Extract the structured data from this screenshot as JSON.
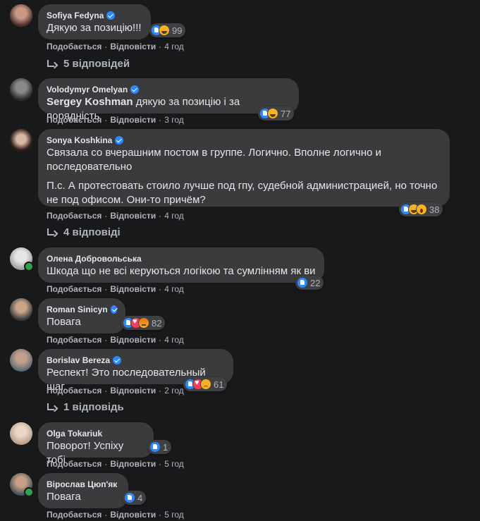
{
  "labels": {
    "like": "Подобається",
    "reply": "Відповісти",
    "sep": "·"
  },
  "comments": [
    {
      "name": "Sofiya Fedyna",
      "verified": true,
      "text": "Дякую за позицію!!!",
      "reactions": [
        "like",
        "haha"
      ],
      "count": "99",
      "time": "4 год",
      "replies": "5 відповідей"
    },
    {
      "name": "Volodymyr Omelyan",
      "verified": true,
      "mention": "Sergey Koshman",
      "text": " дякую за позицію і за порядність",
      "reactions": [
        "like",
        "haha"
      ],
      "count": "77",
      "time": "3 год"
    },
    {
      "name": "Sonya Koshkina",
      "verified": true,
      "text": "Связала со вчерашним постом в группе. Логично. Вполне логично и последовательно",
      "text2": "П.с. А протестовать стоило лучше под гпу, судебной администрацией, но точно не под офисом. Они-то причём?",
      "reactions": [
        "like",
        "haha",
        "wow"
      ],
      "count": "38",
      "time": "4 год",
      "replies": "4 відповіді"
    },
    {
      "name": "Олена Добровольська",
      "verified": false,
      "online": true,
      "text": "Шкода що не всі керуються логікою та сумлінням як ви",
      "reactions": [
        "like"
      ],
      "count": "22",
      "time": "4 год"
    },
    {
      "name": "Roman Sinicyn",
      "verified": true,
      "text": "Повага",
      "reactions": [
        "like",
        "love",
        "angry"
      ],
      "count": "82",
      "time": "4 год"
    },
    {
      "name": "Borislav Bereza",
      "verified": true,
      "text": "Респект! Это последовательный шаг.",
      "reactions": [
        "like",
        "love",
        "sad"
      ],
      "count": "61",
      "time": "2 год",
      "replies": "1 відповідь"
    },
    {
      "name": "Olga Tokariuk",
      "verified": false,
      "text": "Поворот! Успіху тобі",
      "reactions": [
        "like"
      ],
      "count": "1",
      "time": "5 год"
    },
    {
      "name": "Вірослав Цюп'як",
      "verified": false,
      "online": true,
      "text": "Повага",
      "reactions": [
        "like"
      ],
      "count": "4",
      "time": "5 год"
    }
  ]
}
